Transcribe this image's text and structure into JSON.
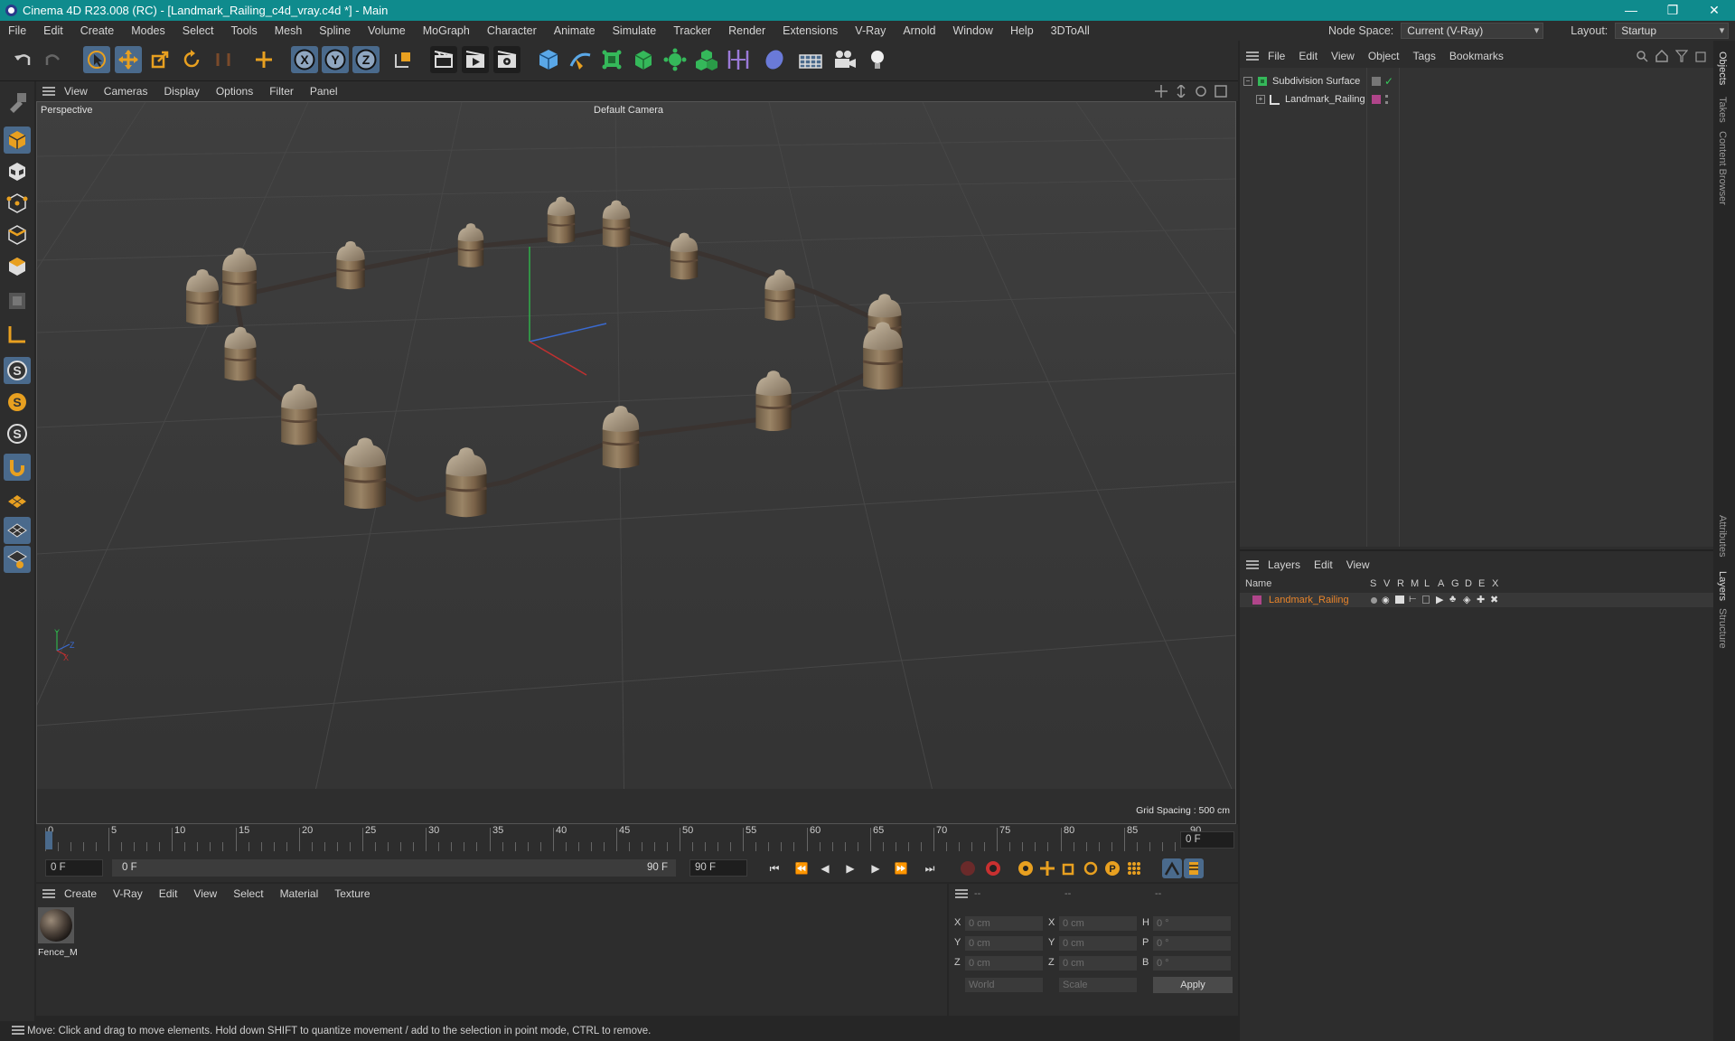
{
  "window": {
    "title": "Cinema 4D R23.008 (RC) - [Landmark_Railing_c4d_vray.c4d *] - Main",
    "minimize": "—",
    "restore": "❐",
    "close": "✕"
  },
  "menu": [
    "File",
    "Edit",
    "Create",
    "Modes",
    "Select",
    "Tools",
    "Mesh",
    "Spline",
    "Volume",
    "MoGraph",
    "Character",
    "Animate",
    "Simulate",
    "Tracker",
    "Render",
    "Extensions",
    "V-Ray",
    "Arnold",
    "Window",
    "Help",
    "3DToAll"
  ],
  "node_space": {
    "label": "Node Space:",
    "value": "Current (V-Ray)"
  },
  "layout": {
    "label": "Layout:",
    "value": "Startup"
  },
  "toolbar_icons": [
    "undo-icon",
    "redo-icon",
    "select-arrow-icon",
    "move-icon",
    "scale-icon",
    "rotate-icon",
    "recent-tool-icon",
    "add-icon",
    "axis-x-icon",
    "axis-y-icon",
    "axis-z-icon",
    "coordinate-system-icon",
    "render-view-icon",
    "render-picture-viewer-icon",
    "render-settings-icon",
    "cube-icon",
    "pen-spline-icon",
    "subdivision-icon",
    "extrude-icon",
    "array-icon",
    "cloner-icon",
    "symmetry-icon",
    "deformer-icon",
    "floor-icon",
    "camera-icon",
    "light-icon"
  ],
  "viewport": {
    "menu": [
      "View",
      "Cameras",
      "Display",
      "Options",
      "Filter",
      "Panel"
    ],
    "label": "Perspective",
    "camera": "Default Camera",
    "grid_spacing": "Grid Spacing : 500 cm"
  },
  "timeline": {
    "ticks": [
      "0",
      "5",
      "10",
      "15",
      "20",
      "25",
      "30",
      "35",
      "40",
      "45",
      "50",
      "55",
      "60",
      "65",
      "70",
      "75",
      "80",
      "85",
      "90"
    ],
    "current_frame": "0 F"
  },
  "transport": {
    "start": "0 F",
    "range_start": "0 F",
    "range_end": "90 F",
    "end": "90 F"
  },
  "materials": {
    "menu": [
      "Create",
      "V-Ray",
      "Edit",
      "View",
      "Select",
      "Material",
      "Texture"
    ],
    "items": [
      {
        "name": "Fence_M"
      }
    ]
  },
  "coordinates": {
    "headers": [
      "--",
      "--",
      "--"
    ],
    "rows": [
      {
        "a": "X",
        "av": "0 cm",
        "b": "X",
        "bv": "0 cm",
        "c": "H",
        "cv": "0 °"
      },
      {
        "a": "Y",
        "av": "0 cm",
        "b": "Y",
        "bv": "0 cm",
        "c": "P",
        "cv": "0 °"
      },
      {
        "a": "Z",
        "av": "0 cm",
        "b": "Z",
        "bv": "0 cm",
        "c": "B",
        "cv": "0 °"
      }
    ],
    "space": "World",
    "mode": "Scale",
    "apply": "Apply"
  },
  "status": "Move: Click and drag to move elements. Hold down SHIFT to quantize movement / add to the selection in point mode, CTRL to remove.",
  "objects": {
    "menu": [
      "File",
      "Edit",
      "View",
      "Object",
      "Tags",
      "Bookmarks"
    ],
    "items": [
      {
        "name": "Subdivision Surface"
      },
      {
        "name": "Landmark_Railing"
      }
    ]
  },
  "layers": {
    "menu": [
      "Layers",
      "Edit",
      "View"
    ],
    "columns": [
      "Name",
      "S",
      "V",
      "R",
      "M",
      "L",
      "A",
      "G",
      "D",
      "E",
      "X"
    ],
    "items": [
      {
        "name": "Landmark_Railing",
        "color": "#b0458a"
      }
    ]
  },
  "side_tabs": [
    "Objects",
    "Takes",
    "Content Browser",
    "Attributes",
    "Layers",
    "Structure"
  ],
  "colors": {
    "accent": "#0f8b8d",
    "selected": "#4a6a8c",
    "layer_text": "#e8842a"
  }
}
